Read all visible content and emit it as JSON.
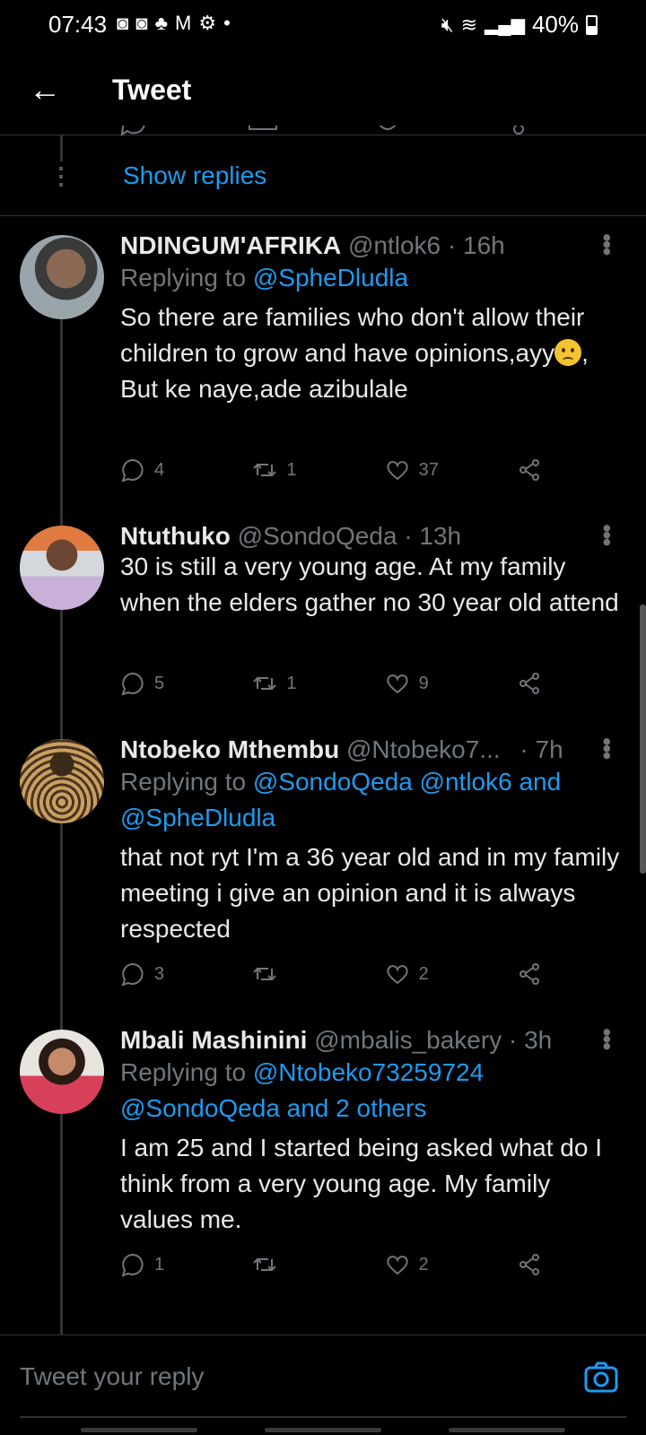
{
  "status_bar": {
    "time": "07:43",
    "battery": "40%",
    "left_icons": [
      "notification-icon",
      "notification-icon",
      "notification-icon",
      "mail-icon",
      "settings-icon",
      "dot-icon"
    ]
  },
  "header": {
    "title": "Tweet",
    "back_icon": "arrow-left-icon"
  },
  "show_replies": "Show replies",
  "tweets": [
    {
      "name": "NDINGUM'AFRIKA",
      "handle": "@ntlok6",
      "time": "· 16h",
      "replying_prefix": "Replying to",
      "replying_to": "@SpheDludla",
      "text_line1": "So there are families who don't allow their children to grow and have opinions,ayy",
      "text_line1_suffix": ",",
      "text_line2": "But ke naye,ade azibulale",
      "replies": "4",
      "retweets": "1",
      "likes": "37",
      "avatar_color": "#7d8a92"
    },
    {
      "name": "Ntuthuko",
      "handle": "@SondoQeda",
      "time": "· 13h",
      "text": "30 is still a very young age. At my family when the elders gather no 30 year old attend",
      "replies": "5",
      "retweets": "1",
      "likes": "9",
      "avatar_color": "#d97a45"
    },
    {
      "name": "Ntobeko Mthembu",
      "handle": "@Ntobeko7...",
      "time": "· 7h",
      "replying_prefix": "Replying to",
      "replying_to": "@SondoQeda @ntlok6 and @SpheDludla",
      "text": "that not ryt I'm a 36 year old and in my family meeting i give an opinion and it is always respected",
      "replies": "3",
      "retweets": "",
      "likes": "2",
      "avatar_color": "#6b5a3a"
    },
    {
      "name": "Mbali Mashinini",
      "handle": "@mbalis_bakery",
      "time": "· 3h",
      "replying_prefix": "Replying to",
      "replying_to": "@Ntobeko73259724 @SondoQeda and 2 others",
      "text": "I am 25 and I started being asked what do I think from a very young age. My family values me.",
      "replies": "1",
      "retweets": "",
      "likes": "2",
      "avatar_color": "#d9b8a8"
    }
  ],
  "reply_bar": {
    "placeholder": "Tweet your reply",
    "camera_icon": "camera-icon"
  },
  "colors": {
    "accent": "#1d9bf0",
    "background": "#000000",
    "muted": "#71767b"
  }
}
